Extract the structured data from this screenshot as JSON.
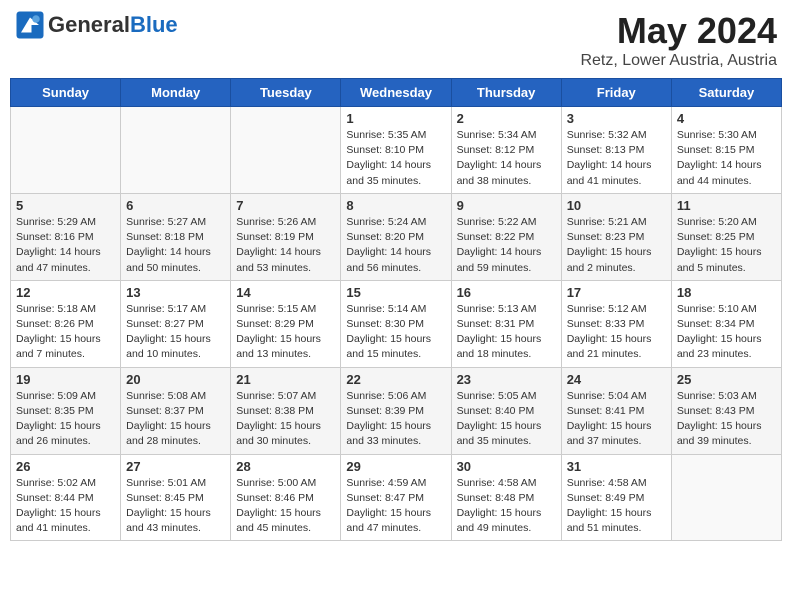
{
  "header": {
    "logo_line1": "General",
    "logo_line2": "Blue",
    "month": "May 2024",
    "location": "Retz, Lower Austria, Austria"
  },
  "days_of_week": [
    "Sunday",
    "Monday",
    "Tuesday",
    "Wednesday",
    "Thursday",
    "Friday",
    "Saturday"
  ],
  "weeks": [
    [
      {
        "day": "",
        "info": ""
      },
      {
        "day": "",
        "info": ""
      },
      {
        "day": "",
        "info": ""
      },
      {
        "day": "1",
        "info": "Sunrise: 5:35 AM\nSunset: 8:10 PM\nDaylight: 14 hours\nand 35 minutes."
      },
      {
        "day": "2",
        "info": "Sunrise: 5:34 AM\nSunset: 8:12 PM\nDaylight: 14 hours\nand 38 minutes."
      },
      {
        "day": "3",
        "info": "Sunrise: 5:32 AM\nSunset: 8:13 PM\nDaylight: 14 hours\nand 41 minutes."
      },
      {
        "day": "4",
        "info": "Sunrise: 5:30 AM\nSunset: 8:15 PM\nDaylight: 14 hours\nand 44 minutes."
      }
    ],
    [
      {
        "day": "5",
        "info": "Sunrise: 5:29 AM\nSunset: 8:16 PM\nDaylight: 14 hours\nand 47 minutes."
      },
      {
        "day": "6",
        "info": "Sunrise: 5:27 AM\nSunset: 8:18 PM\nDaylight: 14 hours\nand 50 minutes."
      },
      {
        "day": "7",
        "info": "Sunrise: 5:26 AM\nSunset: 8:19 PM\nDaylight: 14 hours\nand 53 minutes."
      },
      {
        "day": "8",
        "info": "Sunrise: 5:24 AM\nSunset: 8:20 PM\nDaylight: 14 hours\nand 56 minutes."
      },
      {
        "day": "9",
        "info": "Sunrise: 5:22 AM\nSunset: 8:22 PM\nDaylight: 14 hours\nand 59 minutes."
      },
      {
        "day": "10",
        "info": "Sunrise: 5:21 AM\nSunset: 8:23 PM\nDaylight: 15 hours\nand 2 minutes."
      },
      {
        "day": "11",
        "info": "Sunrise: 5:20 AM\nSunset: 8:25 PM\nDaylight: 15 hours\nand 5 minutes."
      }
    ],
    [
      {
        "day": "12",
        "info": "Sunrise: 5:18 AM\nSunset: 8:26 PM\nDaylight: 15 hours\nand 7 minutes."
      },
      {
        "day": "13",
        "info": "Sunrise: 5:17 AM\nSunset: 8:27 PM\nDaylight: 15 hours\nand 10 minutes."
      },
      {
        "day": "14",
        "info": "Sunrise: 5:15 AM\nSunset: 8:29 PM\nDaylight: 15 hours\nand 13 minutes."
      },
      {
        "day": "15",
        "info": "Sunrise: 5:14 AM\nSunset: 8:30 PM\nDaylight: 15 hours\nand 15 minutes."
      },
      {
        "day": "16",
        "info": "Sunrise: 5:13 AM\nSunset: 8:31 PM\nDaylight: 15 hours\nand 18 minutes."
      },
      {
        "day": "17",
        "info": "Sunrise: 5:12 AM\nSunset: 8:33 PM\nDaylight: 15 hours\nand 21 minutes."
      },
      {
        "day": "18",
        "info": "Sunrise: 5:10 AM\nSunset: 8:34 PM\nDaylight: 15 hours\nand 23 minutes."
      }
    ],
    [
      {
        "day": "19",
        "info": "Sunrise: 5:09 AM\nSunset: 8:35 PM\nDaylight: 15 hours\nand 26 minutes."
      },
      {
        "day": "20",
        "info": "Sunrise: 5:08 AM\nSunset: 8:37 PM\nDaylight: 15 hours\nand 28 minutes."
      },
      {
        "day": "21",
        "info": "Sunrise: 5:07 AM\nSunset: 8:38 PM\nDaylight: 15 hours\nand 30 minutes."
      },
      {
        "day": "22",
        "info": "Sunrise: 5:06 AM\nSunset: 8:39 PM\nDaylight: 15 hours\nand 33 minutes."
      },
      {
        "day": "23",
        "info": "Sunrise: 5:05 AM\nSunset: 8:40 PM\nDaylight: 15 hours\nand 35 minutes."
      },
      {
        "day": "24",
        "info": "Sunrise: 5:04 AM\nSunset: 8:41 PM\nDaylight: 15 hours\nand 37 minutes."
      },
      {
        "day": "25",
        "info": "Sunrise: 5:03 AM\nSunset: 8:43 PM\nDaylight: 15 hours\nand 39 minutes."
      }
    ],
    [
      {
        "day": "26",
        "info": "Sunrise: 5:02 AM\nSunset: 8:44 PM\nDaylight: 15 hours\nand 41 minutes."
      },
      {
        "day": "27",
        "info": "Sunrise: 5:01 AM\nSunset: 8:45 PM\nDaylight: 15 hours\nand 43 minutes."
      },
      {
        "day": "28",
        "info": "Sunrise: 5:00 AM\nSunset: 8:46 PM\nDaylight: 15 hours\nand 45 minutes."
      },
      {
        "day": "29",
        "info": "Sunrise: 4:59 AM\nSunset: 8:47 PM\nDaylight: 15 hours\nand 47 minutes."
      },
      {
        "day": "30",
        "info": "Sunrise: 4:58 AM\nSunset: 8:48 PM\nDaylight: 15 hours\nand 49 minutes."
      },
      {
        "day": "31",
        "info": "Sunrise: 4:58 AM\nSunset: 8:49 PM\nDaylight: 15 hours\nand 51 minutes."
      },
      {
        "day": "",
        "info": ""
      }
    ]
  ]
}
